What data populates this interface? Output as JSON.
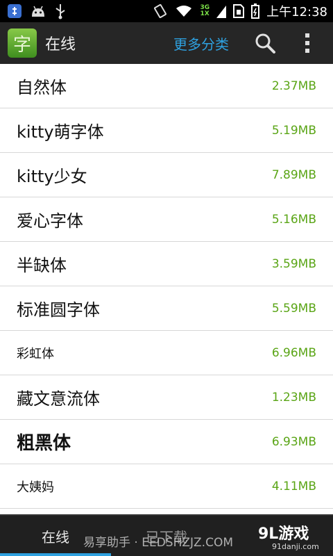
{
  "status_bar": {
    "network_type_top": "3G",
    "network_type_bottom": "1X",
    "time": "上午12:38"
  },
  "action_bar": {
    "app_icon_glyph": "字",
    "title": "在线",
    "more_categories": "更多分类"
  },
  "fonts": [
    {
      "name": "自然体",
      "size": "2.37MB"
    },
    {
      "name": "kitty萌字体",
      "size": "5.19MB"
    },
    {
      "name": "kitty少女",
      "size": "7.89MB"
    },
    {
      "name": "爱心字体",
      "size": "5.16MB"
    },
    {
      "name": "半缺体",
      "size": "3.59MB"
    },
    {
      "name": "标准圆字体",
      "size": "5.59MB"
    },
    {
      "name": "彩虹体",
      "size": "6.96MB"
    },
    {
      "name": "藏文意流体",
      "size": "1.23MB"
    },
    {
      "name": "粗黑体",
      "size": "6.93MB"
    },
    {
      "name": "大姨妈",
      "size": "4.11MB"
    }
  ],
  "tabs": {
    "online": "在线",
    "downloaded": "已下载"
  },
  "watermark": {
    "text": "易享助手 · EEDSHZJZ.COM",
    "brand": "9L游戏",
    "site": "91danji.com"
  },
  "colors": {
    "accent_blue": "#2ea1e0",
    "size_green": "#5aa516",
    "actionbar_bg": "#262626"
  }
}
